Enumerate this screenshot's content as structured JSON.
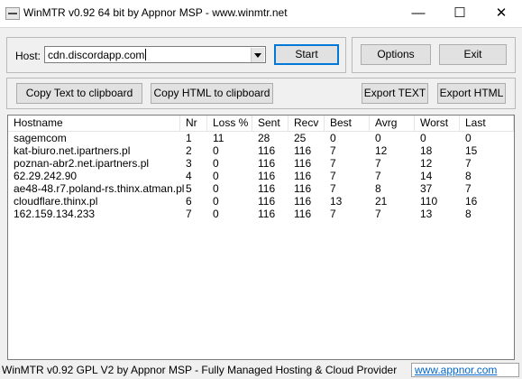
{
  "window": {
    "title": "WinMTR v0.92 64 bit by Appnor MSP - www.winmtr.net",
    "icon": "app-icon",
    "controls": {
      "minimize": "—",
      "maximize": "☐",
      "close": "✕"
    }
  },
  "host": {
    "label": "Host:",
    "value": "cdn.discordapp.com",
    "start_label": "Start"
  },
  "toolbar": {
    "options_label": "Options",
    "exit_label": "Exit",
    "copy_text_label": "Copy Text to clipboard",
    "copy_html_label": "Copy HTML to clipboard",
    "export_text_label": "Export TEXT",
    "export_html_label": "Export HTML"
  },
  "table": {
    "columns": [
      "Hostname",
      "Nr",
      "Loss %",
      "Sent",
      "Recv",
      "Best",
      "Avrg",
      "Worst",
      "Last"
    ],
    "rows": [
      [
        "sagemcom",
        "1",
        "11",
        "28",
        "25",
        "0",
        "0",
        "0",
        "0"
      ],
      [
        "kat-biuro.net.ipartners.pl",
        "2",
        "0",
        "116",
        "116",
        "7",
        "12",
        "18",
        "15"
      ],
      [
        "poznan-abr2.net.ipartners.pl",
        "3",
        "0",
        "116",
        "116",
        "7",
        "7",
        "12",
        "7"
      ],
      [
        "62.29.242.90",
        "4",
        "0",
        "116",
        "116",
        "7",
        "7",
        "14",
        "8"
      ],
      [
        "ae48-48.r7.poland-rs.thinx.atman.pl",
        "5",
        "0",
        "116",
        "116",
        "7",
        "8",
        "37",
        "7"
      ],
      [
        "cloudflare.thinx.pl",
        "6",
        "0",
        "116",
        "116",
        "13",
        "21",
        "110",
        "16"
      ],
      [
        "162.159.134.233",
        "7",
        "0",
        "116",
        "116",
        "7",
        "7",
        "13",
        "8"
      ]
    ]
  },
  "status": {
    "text": "WinMTR v0.92 GPL V2 by Appnor MSP - Fully Managed Hosting & Cloud Provider",
    "link": "www.appnor.com"
  },
  "colors": {
    "link": "#0066cc",
    "default_button_border": "#0078d7"
  }
}
